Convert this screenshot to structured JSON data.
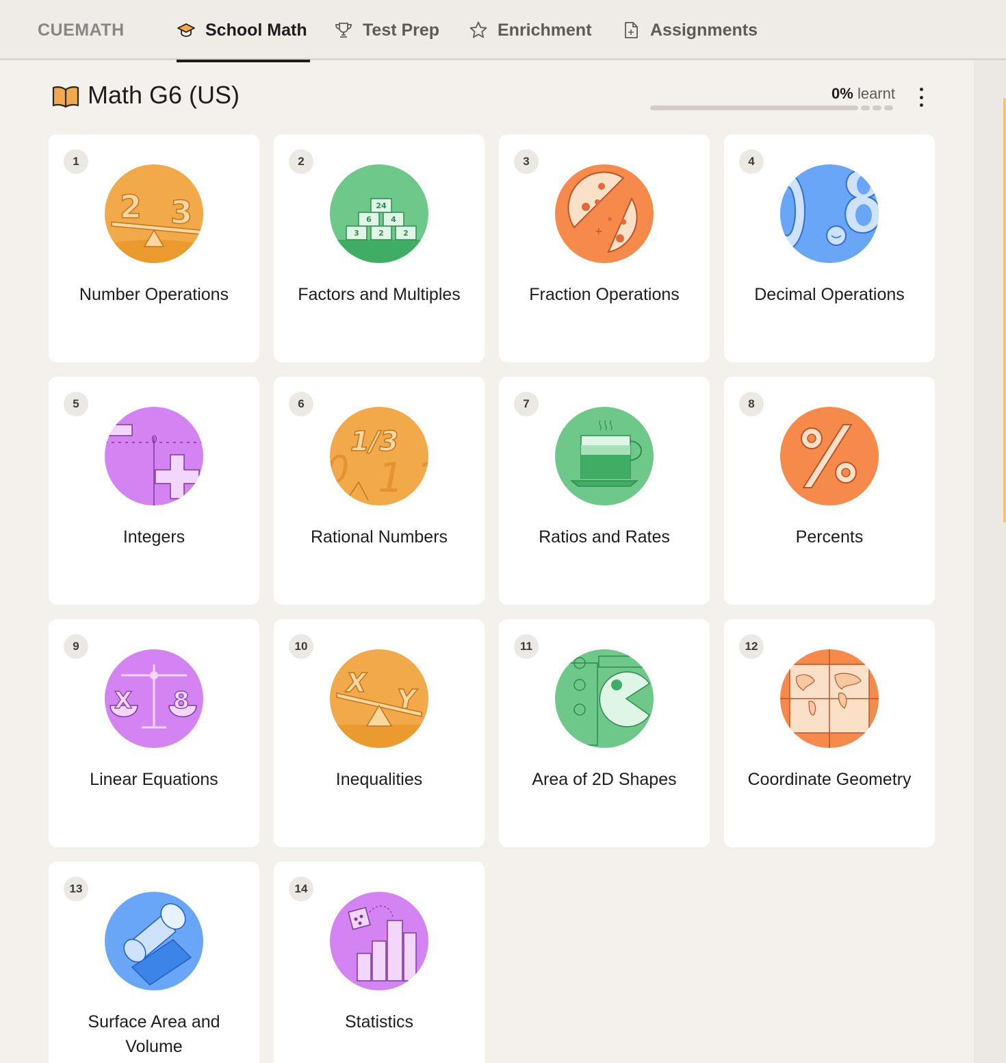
{
  "header": {
    "brand": "CUEMATH",
    "tabs": [
      {
        "label": "School Math",
        "icon": "graduation-cap-icon",
        "active": true
      },
      {
        "label": "Test Prep",
        "icon": "trophy-icon",
        "active": false
      },
      {
        "label": "Enrichment",
        "icon": "star-icon",
        "active": false
      },
      {
        "label": "Assignments",
        "icon": "document-icon",
        "active": false
      }
    ]
  },
  "course": {
    "icon": "open-book-icon",
    "title": "Math G6 (US)",
    "progress_value": "0%",
    "progress_suffix": "learnt",
    "progress_fraction": 0
  },
  "chapters": [
    {
      "number": "1",
      "title": "Number Operations",
      "icon": "balance-2-3-illustration",
      "color": "#f2a94a"
    },
    {
      "number": "2",
      "title": "Factors and Multiples",
      "icon": "number-blocks-illustration",
      "color": "#64c584"
    },
    {
      "number": "3",
      "title": "Fraction Operations",
      "icon": "pizza-slices-illustration",
      "color": "#f58a4b"
    },
    {
      "number": "4",
      "title": "Decimal Operations",
      "icon": "decimal-digits-illustration",
      "color": "#69a6f7"
    },
    {
      "number": "5",
      "title": "Integers",
      "icon": "number-line-plus-illustration",
      "color": "#d483f2"
    },
    {
      "number": "6",
      "title": "Rational Numbers",
      "icon": "fraction-one-third-illustration",
      "color": "#f2a94a"
    },
    {
      "number": "7",
      "title": "Ratios and Rates",
      "icon": "coffee-cup-illustration",
      "color": "#64c584"
    },
    {
      "number": "8",
      "title": "Percents",
      "icon": "percent-sign-illustration",
      "color": "#f58a4b"
    },
    {
      "number": "9",
      "title": "Linear Equations",
      "icon": "scale-x-8-illustration",
      "color": "#d483f2"
    },
    {
      "number": "10",
      "title": "Inequalities",
      "icon": "seesaw-x-y-illustration",
      "color": "#f2a94a"
    },
    {
      "number": "11",
      "title": "Area of 2D Shapes",
      "icon": "pacman-shape-illustration",
      "color": "#64c584"
    },
    {
      "number": "12",
      "title": "Coordinate Geometry",
      "icon": "world-map-grid-illustration",
      "color": "#f58a4b"
    },
    {
      "number": "13",
      "title": "Surface Area and Volume",
      "icon": "cylinder-net-illustration",
      "color": "#69a6f7"
    },
    {
      "number": "14",
      "title": "Statistics",
      "icon": "dice-bar-chart-illustration",
      "color": "#d483f2"
    }
  ]
}
